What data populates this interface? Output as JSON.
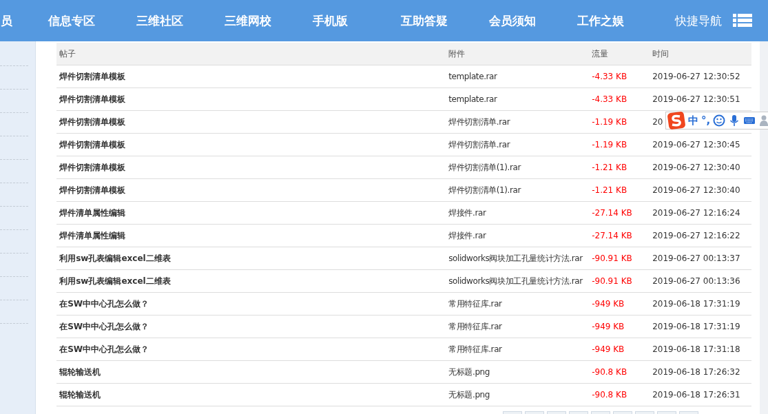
{
  "nav": {
    "items": [
      {
        "label": "员"
      },
      {
        "label": "信息专区"
      },
      {
        "label": "三维社区"
      },
      {
        "label": "三维网校"
      },
      {
        "label": "手机版"
      },
      {
        "label": "互助答疑"
      },
      {
        "label": "会员须知"
      },
      {
        "label": "工作之娱"
      }
    ],
    "quick_nav": "快捷导航"
  },
  "table": {
    "columns": [
      "帖子",
      "附件",
      "流量",
      "时间"
    ],
    "rows": [
      {
        "post": "焊件切割清单模板",
        "attachment": "template.rar",
        "traffic": "-4.33 KB",
        "time": "2019-06-27 12:30:52"
      },
      {
        "post": "焊件切割清单模板",
        "attachment": "template.rar",
        "traffic": "-4.33 KB",
        "time": "2019-06-27 12:30:51"
      },
      {
        "post": "焊件切割清单模板",
        "attachment": "焊件切割清单.rar",
        "traffic": "-1.19 KB",
        "time": "20"
      },
      {
        "post": "焊件切割清单模板",
        "attachment": "焊件切割清单.rar",
        "traffic": "-1.19 KB",
        "time": "2019-06-27 12:30:45"
      },
      {
        "post": "焊件切割清单模板",
        "attachment": "焊件切割清单(1).rar",
        "traffic": "-1.21 KB",
        "time": "2019-06-27 12:30:40"
      },
      {
        "post": "焊件切割清单模板",
        "attachment": "焊件切割清单(1).rar",
        "traffic": "-1.21 KB",
        "time": "2019-06-27 12:30:40"
      },
      {
        "post": "焊件清单属性编辑",
        "attachment": "焊接件.rar",
        "traffic": "-27.14 KB",
        "time": "2019-06-27 12:16:24"
      },
      {
        "post": "焊件清单属性编辑",
        "attachment": "焊接件.rar",
        "traffic": "-27.14 KB",
        "time": "2019-06-27 12:16:22"
      },
      {
        "post": "利用sw孔表编辑excel二维表",
        "attachment": "solidworks阀块加工孔量统计方法.rar",
        "traffic": "-90.91 KB",
        "time": "2019-06-27 00:13:37"
      },
      {
        "post": "利用sw孔表编辑excel二维表",
        "attachment": "solidworks阀块加工孔量统计方法.rar",
        "traffic": "-90.91 KB",
        "time": "2019-06-27 00:13:36"
      },
      {
        "post": "在SW中中心孔怎么做？",
        "attachment": "常用特征库.rar",
        "traffic": "-949 KB",
        "time": "2019-06-18 17:31:19"
      },
      {
        "post": "在SW中中心孔怎么做？",
        "attachment": "常用特征库.rar",
        "traffic": "-949 KB",
        "time": "2019-06-18 17:31:19"
      },
      {
        "post": "在SW中中心孔怎么做？",
        "attachment": "常用特征库.rar",
        "traffic": "-949 KB",
        "time": "2019-06-18 17:31:18"
      },
      {
        "post": "辊轮输送机",
        "attachment": "无标题.png",
        "traffic": "-90.8 KB",
        "time": "2019-06-18 17:26:32"
      },
      {
        "post": "辊轮输送机",
        "attachment": "无标题.png",
        "traffic": "-90.8 KB",
        "time": "2019-06-18 17:26:31"
      }
    ]
  },
  "ime_toolbar": {
    "mode": "中",
    "punctuation": "°,"
  }
}
